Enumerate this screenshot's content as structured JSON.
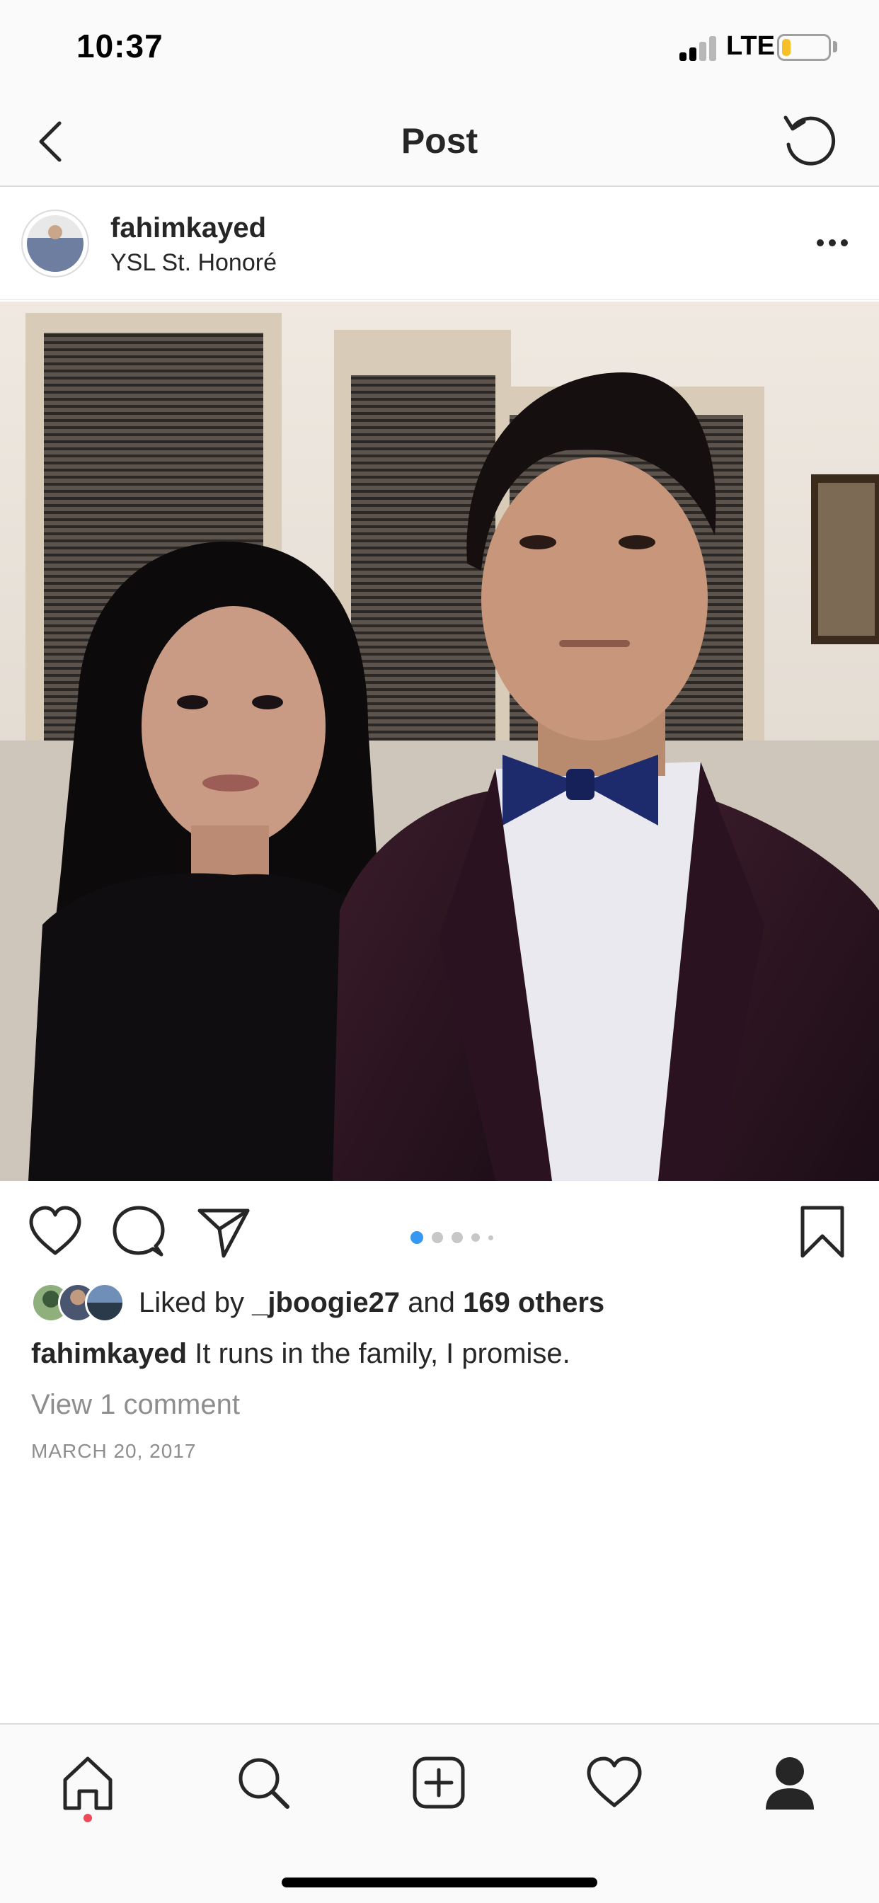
{
  "status_bar": {
    "time": "10:37",
    "network": "LTE",
    "battery_level": 0.2,
    "battery_color": "#f6c026"
  },
  "nav": {
    "title": "Post",
    "back_icon": "chevron-left-icon",
    "refresh_icon": "refresh-icon"
  },
  "post": {
    "username": "fahimkayed",
    "location": "YSL St. Honoré",
    "carousel": {
      "total": 5,
      "current": 1,
      "active_color": "#3897f0"
    },
    "likes": {
      "prefix": "Liked by",
      "user": "_jboogie27",
      "joiner": "and",
      "others": "169 others"
    },
    "caption": {
      "username": "fahimkayed",
      "text": " It runs in the family, I promise."
    },
    "view_comments": "View 1 comment",
    "date": "MARCH 20, 2017"
  },
  "tabs": [
    {
      "name": "home",
      "icon": "home-icon",
      "active": true
    },
    {
      "name": "search",
      "icon": "search-icon",
      "active": false
    },
    {
      "name": "new-post",
      "icon": "add-post-icon",
      "active": false
    },
    {
      "name": "activity",
      "icon": "heart-icon",
      "active": false
    },
    {
      "name": "profile",
      "icon": "profile-icon",
      "active": false
    }
  ],
  "colors": {
    "text": "#262626",
    "muted": "#8e8e8e",
    "notification": "#ed4956"
  }
}
